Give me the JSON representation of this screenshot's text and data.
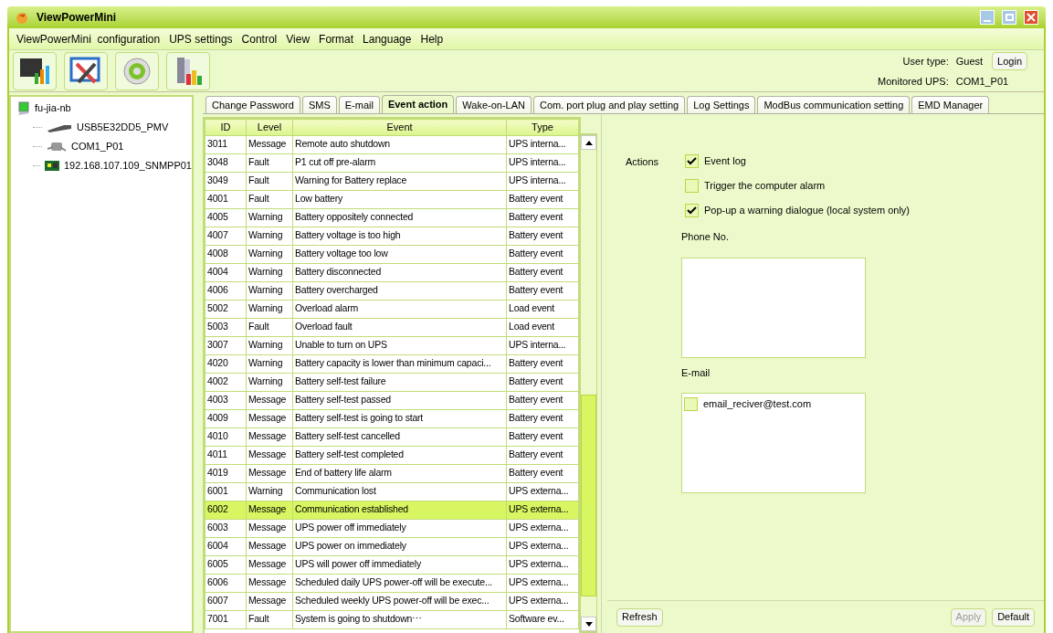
{
  "window": {
    "title": "ViewPowerMini"
  },
  "menu": [
    "ViewPowerMini  configuration",
    "UPS settings",
    "Control",
    "View",
    "Format",
    "Language",
    "Help"
  ],
  "user": {
    "type_label": "User type:",
    "type_value": "Guest",
    "login": "Login",
    "monitored_label": "Monitored UPS:",
    "monitored_value": "COM1_P01"
  },
  "tree": [
    {
      "label": "fu-jia-nb",
      "kind": "computer",
      "children": [
        {
          "label": "USB5E32DD5_PMV",
          "kind": "usb"
        },
        {
          "label": "COM1_P01",
          "kind": "serial"
        },
        {
          "label": "192.168.107.109_SNMPP01",
          "kind": "card"
        }
      ]
    }
  ],
  "tabs": [
    {
      "label": "Change Password",
      "selected": false
    },
    {
      "label": "SMS",
      "selected": false
    },
    {
      "label": "E-mail",
      "selected": false
    },
    {
      "label": "Event action",
      "selected": true
    },
    {
      "label": "Wake-on-LAN",
      "selected": false
    },
    {
      "label": "Com. port plug and play setting",
      "selected": false
    },
    {
      "label": "Log Settings",
      "selected": false
    },
    {
      "label": "ModBus communication setting",
      "selected": false
    },
    {
      "label": "EMD Manager",
      "selected": false
    }
  ],
  "table": {
    "columns": [
      "ID",
      "Level",
      "Event",
      "Type"
    ],
    "rows": [
      {
        "cells": [
          "3011",
          "Message",
          "Remote auto shutdown",
          "UPS interna..."
        ],
        "selected": false
      },
      {
        "cells": [
          "3048",
          "Fault",
          "P1 cut off pre-alarm",
          "UPS interna..."
        ],
        "selected": false
      },
      {
        "cells": [
          "3049",
          "Fault",
          "Warning for Battery replace",
          "UPS interna..."
        ],
        "selected": false
      },
      {
        "cells": [
          "4001",
          "Fault",
          "Low battery",
          "Battery event"
        ],
        "selected": false
      },
      {
        "cells": [
          "4005",
          "Warning",
          "Battery oppositely connected",
          "Battery event"
        ],
        "selected": false
      },
      {
        "cells": [
          "4007",
          "Warning",
          "Battery voltage is too high",
          "Battery event"
        ],
        "selected": false
      },
      {
        "cells": [
          "4008",
          "Warning",
          "Battery voltage too low",
          "Battery event"
        ],
        "selected": false
      },
      {
        "cells": [
          "4004",
          "Warning",
          "Battery disconnected",
          "Battery event"
        ],
        "selected": false
      },
      {
        "cells": [
          "4006",
          "Warning",
          "Battery overcharged",
          "Battery event"
        ],
        "selected": false
      },
      {
        "cells": [
          "5002",
          "Warning",
          "Overload alarm",
          "Load event"
        ],
        "selected": false
      },
      {
        "cells": [
          "5003",
          "Fault",
          "Overload fault",
          "Load event"
        ],
        "selected": false
      },
      {
        "cells": [
          "3007",
          "Warning",
          "Unable to turn on UPS",
          "UPS interna..."
        ],
        "selected": false
      },
      {
        "cells": [
          "4020",
          "Warning",
          "Battery capacity is lower than minimum capaci...",
          "Battery event"
        ],
        "selected": false
      },
      {
        "cells": [
          "4002",
          "Warning",
          "Battery self-test failure",
          "Battery event"
        ],
        "selected": false
      },
      {
        "cells": [
          "4003",
          "Message",
          "Battery self-test passed",
          "Battery event"
        ],
        "selected": false
      },
      {
        "cells": [
          "4009",
          "Message",
          "Battery self-test is going to start",
          "Battery event"
        ],
        "selected": false
      },
      {
        "cells": [
          "4010",
          "Message",
          "Battery self-test cancelled",
          "Battery event"
        ],
        "selected": false
      },
      {
        "cells": [
          "4011",
          "Message",
          "Battery self-test completed",
          "Battery event"
        ],
        "selected": false
      },
      {
        "cells": [
          "4019",
          "Message",
          "End of battery life alarm",
          "Battery event"
        ],
        "selected": false
      },
      {
        "cells": [
          "6001",
          "Warning",
          "Communication lost",
          "UPS externa..."
        ],
        "selected": false
      },
      {
        "cells": [
          "6002",
          "Message",
          "Communication established",
          "UPS externa..."
        ],
        "selected": true
      },
      {
        "cells": [
          "6003",
          "Message",
          "UPS power off immediately",
          "UPS externa..."
        ],
        "selected": false
      },
      {
        "cells": [
          "6004",
          "Message",
          "UPS power on immediately",
          "UPS externa..."
        ],
        "selected": false
      },
      {
        "cells": [
          "6005",
          "Message",
          "UPS will power off immediately",
          "UPS externa..."
        ],
        "selected": false
      },
      {
        "cells": [
          "6006",
          "Message",
          "Scheduled daily UPS power-off will be execute...",
          "UPS externa..."
        ],
        "selected": false
      },
      {
        "cells": [
          "6007",
          "Message",
          "Scheduled weekly UPS power-off will be exec...",
          "UPS externa..."
        ],
        "selected": false
      },
      {
        "cells": [
          "7001",
          "Fault",
          "System is going to shutdown⋯",
          "Software ev..."
        ],
        "selected": false
      }
    ]
  },
  "actions": {
    "label": "Actions",
    "options": [
      {
        "label": "Event log",
        "checked": true
      },
      {
        "label": "Trigger the computer alarm",
        "checked": false
      },
      {
        "label": "Pop-up a warning dialogue (local system only)",
        "checked": true
      }
    ]
  },
  "phone": {
    "label": "Phone No."
  },
  "email": {
    "label": "E-mail",
    "recipients": [
      {
        "address": "email_reciver@test.com",
        "checked": false
      }
    ]
  },
  "buttons": [
    {
      "label": "Refresh",
      "disabled": false
    },
    {
      "label": "Apply",
      "disabled": true
    },
    {
      "label": "Default",
      "disabled": false
    }
  ]
}
